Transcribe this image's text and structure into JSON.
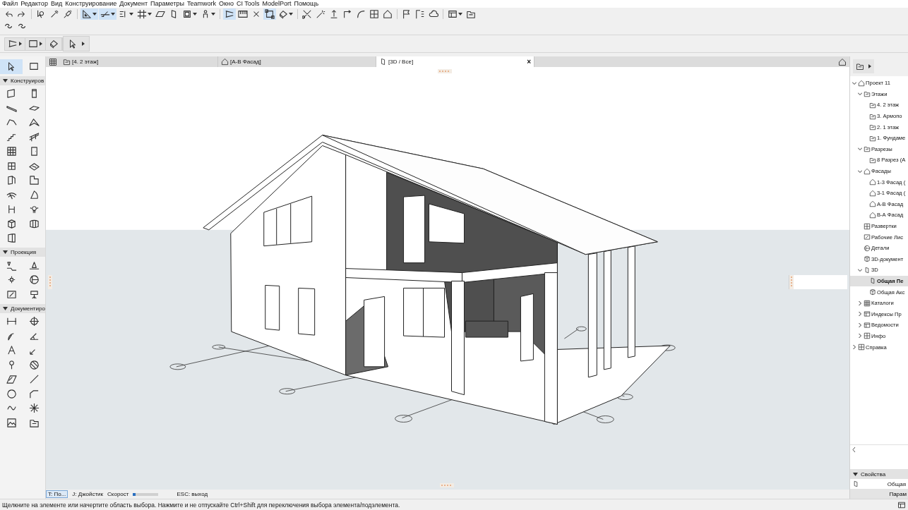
{
  "menu": [
    "Файл",
    "Редактор",
    "Вид",
    "Конструирование",
    "Документ",
    "Параметры",
    "Teamwork",
    "Окно",
    "CI Tools",
    "ModelPort",
    "Помощь"
  ],
  "tabs": [
    {
      "label": "[4. 2 этаж]",
      "kind": "story",
      "selected": false
    },
    {
      "label": "[А-В Фасад]",
      "kind": "elevation",
      "selected": false
    },
    {
      "label": "[3D / Все]",
      "kind": "view",
      "selected": true,
      "close": "×"
    }
  ],
  "toolbox": {
    "sections": [
      {
        "title": "Конструиров",
        "expanded": true
      },
      {
        "title": "Проекция",
        "expanded": true
      },
      {
        "title": "Документиро",
        "expanded": true
      }
    ]
  },
  "navigator": {
    "items": [
      {
        "label": "Проект 11",
        "kind": "project",
        "expanded": true,
        "selected": false,
        "children": [
          {
            "label": "Этажи",
            "kind": "story",
            "expanded": true,
            "selected": false,
            "children": [
              {
                "label": "4. 2 этаж",
                "kind": "story",
                "selected": false
              },
              {
                "label": "3. Армопо",
                "kind": "story",
                "selected": false
              },
              {
                "label": "2. 1 этаж",
                "kind": "story",
                "selected": false
              },
              {
                "label": "1. Фундаме",
                "kind": "story",
                "selected": false
              }
            ]
          },
          {
            "label": "Разрезы",
            "kind": "section",
            "expanded": true,
            "selected": false,
            "children": [
              {
                "label": "8 Разрез (А",
                "kind": "section",
                "selected": false
              }
            ]
          },
          {
            "label": "Фасады",
            "kind": "elevation",
            "expanded": true,
            "selected": false,
            "children": [
              {
                "label": "1-3 Фасад (",
                "kind": "elevation",
                "selected": false
              },
              {
                "label": "3-1 Фасад (",
                "kind": "elevation",
                "selected": false
              },
              {
                "label": "А-В Фасад",
                "kind": "elevation",
                "selected": false
              },
              {
                "label": "В-А Фасад",
                "kind": "elevation",
                "selected": false
              }
            ]
          },
          {
            "label": "Развертки",
            "kind": "interior",
            "selected": false
          },
          {
            "label": "Рабочие Лис",
            "kind": "worksheet",
            "selected": false
          },
          {
            "label": "Детали",
            "kind": "detail",
            "selected": false
          },
          {
            "label": "3D-документ",
            "kind": "doc3d",
            "selected": false
          },
          {
            "label": "3D",
            "kind": "view",
            "expanded": true,
            "selected": false,
            "children": [
              {
                "label": "Общая Пе",
                "kind": "view",
                "selected": true
              },
              {
                "label": "Общая Акс",
                "kind": "axon",
                "selected": false
              }
            ]
          },
          {
            "label": "Каталоги",
            "kind": "grid",
            "expanded": false,
            "selected": false
          },
          {
            "label": "Индексы Пр",
            "kind": "index",
            "expanded": false,
            "selected": false
          },
          {
            "label": "Ведомости",
            "kind": "list",
            "expanded": false,
            "selected": false
          },
          {
            "label": "Инфо",
            "kind": "info",
            "expanded": false,
            "selected": false
          }
        ]
      },
      {
        "label": "Справка",
        "kind": "info",
        "expanded": false,
        "selected": false
      }
    ]
  },
  "properties": {
    "title": "Свойства",
    "expanded": true,
    "row": "Общая",
    "button": "Парам"
  },
  "view_status": {
    "items": [
      "T: По...",
      "J: Джойстик",
      "Скорост"
    ],
    "speed": {
      "level": 0.1
    },
    "escape": "ESC: выход"
  },
  "status_bar": {
    "message": "Щелкните на элементе или начертите область выбора. Нажмите и не отпускайте Ctrl+Shift для переключения выбора элемента/подэлемента."
  }
}
